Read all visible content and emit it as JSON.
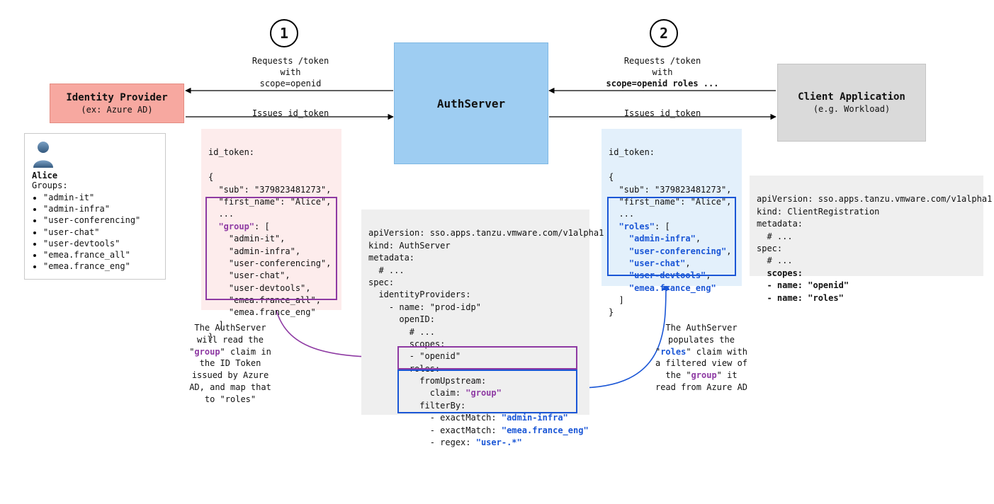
{
  "steps": {
    "one": "1",
    "two": "2"
  },
  "idp": {
    "title": "Identity Provider",
    "subtitle": "(ex: Azure AD)"
  },
  "auth": {
    "title": "AuthServer"
  },
  "client": {
    "title": "Client Application",
    "subtitle": "(e.g. Workload)"
  },
  "user": {
    "name": "Alice",
    "groups_label": "Groups:",
    "groups": [
      "\"admin-it\"",
      "\"admin-infra\"",
      "\"user-conferencing\"",
      "\"user-chat\"",
      "\"user-devtools\"",
      "\"emea.france_all\"",
      "\"emea.france_eng\""
    ]
  },
  "flow1": {
    "request_l1": "Requests /token",
    "request_l2": "with",
    "request_l3": "scope=openid",
    "response": "Issues id_token"
  },
  "flow2": {
    "request_l1": "Requests /token",
    "request_l2": "with",
    "request_l3": "scope=openid roles ...",
    "response": "Issues id_token"
  },
  "token1": {
    "header": "id_token:",
    "open": "{",
    "sub": "  \"sub\": \"379823481273\",",
    "first_name": "  \"first_name\": \"Alice\",",
    "ellipsis": "  ...",
    "group_key": "\"group\"",
    "group_open_suffix": ": [",
    "g0": "    \"admin-it\",",
    "g1": "    \"admin-infra\",",
    "g2": "    \"user-conferencing\",",
    "g3": "    \"user-chat\",",
    "g4": "    \"user-devtools\",",
    "g5": "    \"emea.france_all\",",
    "g6": "    \"emea.france_eng\"",
    "group_close": "  ]",
    "close": "}"
  },
  "token2": {
    "header": "id_token:",
    "open": "{",
    "sub": "  \"sub\": \"379823481273\",",
    "first_name": "  \"first_name\": \"Alice\",",
    "ellipsis": "  ...",
    "roles_key": "\"roles\"",
    "roles_open_suffix": ": [",
    "r0": "\"admin-infra\"",
    "r1": "\"user-conferencing\"",
    "r2": "\"user-chat\"",
    "r3": "\"user-devtools\"",
    "r4": "\"emea.france_eng\"",
    "roles_close": "  ]",
    "close": "}",
    "comma": ","
  },
  "authserver_yaml": {
    "l0": "apiVersion: sso.apps.tanzu.vmware.com/v1alpha1",
    "l1": "kind: AuthServer",
    "l2": "metadata:",
    "l3": "  # ...",
    "l4": "spec:",
    "l5": "  identityProviders:",
    "l6": "    - name: \"prod-idp\"",
    "l7": "      openID:",
    "l8": "        # ...",
    "l9": "        scopes:",
    "l10": "        - \"openid\"",
    "l11": "        roles:",
    "fu_prefix": "          fromUpstream:",
    "fu_claim_prefix": "            claim: ",
    "fu_claim_val": "\"group\"",
    "fb_prefix": "          filterBy:",
    "fb0_prefix": "            - exactMatch: ",
    "fb0_val": "\"admin-infra\"",
    "fb1_prefix": "            - exactMatch: ",
    "fb1_val": "\"emea.france_eng\"",
    "fb2_prefix": "            - regex: ",
    "fb2_val": "\"user-.*\""
  },
  "client_yaml": {
    "l0": "apiVersion: sso.apps.tanzu.vmware.com/v1alpha1",
    "l1": "kind: ClientRegistration",
    "l2": "metadata:",
    "l3": "  # ...",
    "l4": "spec:",
    "l5": "  # ...",
    "scopes_label": "  scopes:",
    "s0": "  - name: \"openid\"",
    "s1": "  - name: \"roles\""
  },
  "explain1": {
    "l0": "The AuthServer",
    "l1": "will read the",
    "l2_pre": "\"",
    "l2_key": "group",
    "l2_post": "\" claim in",
    "l3": "the ID Token",
    "l4": "issued by Azure",
    "l5": "AD, and map that",
    "l6": "to \"roles\""
  },
  "explain2": {
    "l0": "The AuthServer",
    "l1": "populates the",
    "l2_pre": "\"",
    "l2_key": "roles",
    "l2_post": "\" claim with",
    "l3": "a filtered view of",
    "l4_pre": "the \"",
    "l4_key": "group",
    "l4_post": "\" it",
    "l5": "read from Azure AD"
  },
  "colors": {
    "purple": "#8e3aa3",
    "blue": "#1a56d6"
  }
}
